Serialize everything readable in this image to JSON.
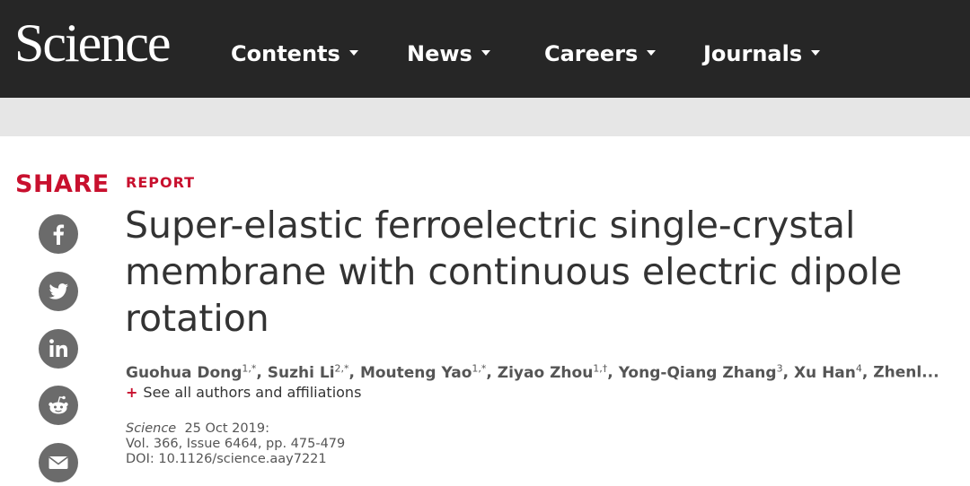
{
  "header": {
    "logo": "Science",
    "nav": [
      "Contents",
      "News",
      "Careers",
      "Journals"
    ]
  },
  "share": {
    "label": "SHARE",
    "icons": [
      "facebook-icon",
      "twitter-icon",
      "linkedin-icon",
      "reddit-icon",
      "email-icon"
    ]
  },
  "article": {
    "type_label": "REPORT",
    "title": "Super-elastic ferroelectric single-crystal membrane with continuous electric dipole rotation",
    "authors": [
      {
        "name": "Guohua Dong",
        "sup": "1,*"
      },
      {
        "name": "Suzhi Li",
        "sup": "2,*"
      },
      {
        "name": "Mouteng Yao",
        "sup": "1,*"
      },
      {
        "name": "Ziyao Zhou",
        "sup": "1,†"
      },
      {
        "name": "Yong-Qiang Zhang",
        "sup": "3"
      },
      {
        "name": "Xu Han",
        "sup": "4"
      },
      {
        "name": "Zhenl...",
        "sup": ""
      }
    ],
    "see_all": "See all authors and affiliations",
    "journal": "Science",
    "date": "25 Oct 2019:",
    "volume": "Vol. 366, Issue 6464, pp. 475-479",
    "doi": "DOI: 10.1126/science.aay7221"
  },
  "colors": {
    "nav_bg": "#262626",
    "accent": "#c8102e",
    "icon_bg": "#6b6b6b"
  }
}
